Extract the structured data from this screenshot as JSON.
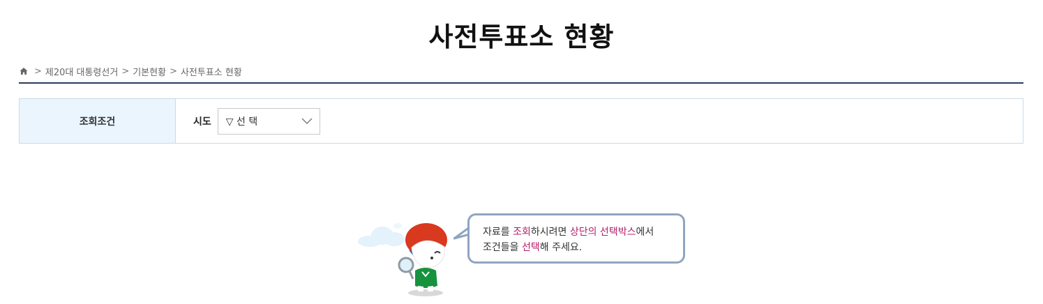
{
  "page": {
    "title": "사전투표소 현황"
  },
  "breadcrumb": {
    "home_icon": "home-icon",
    "separator": ">",
    "items": [
      "제20대 대통령선거",
      "기본현황",
      "사전투표소 현황"
    ]
  },
  "filter": {
    "label": "조회조건",
    "field_label": "시도",
    "select": {
      "selected": "▽ 선 택",
      "icon": "chevron-down-icon"
    }
  },
  "empty_state": {
    "line1": {
      "p1": "자료를 ",
      "h1": "조회",
      "p2": "하시려면 ",
      "h2": "상단의 선택박스",
      "p3": "에서"
    },
    "line2": {
      "p1": "조건들을 ",
      "h1": "선택",
      "p2": "해 주세요."
    }
  },
  "colors": {
    "highlight": "#b41d6a",
    "divider": "#2b3b5c",
    "label_bg": "#eaf5fe",
    "bubble_border": "#8fa5bf"
  }
}
